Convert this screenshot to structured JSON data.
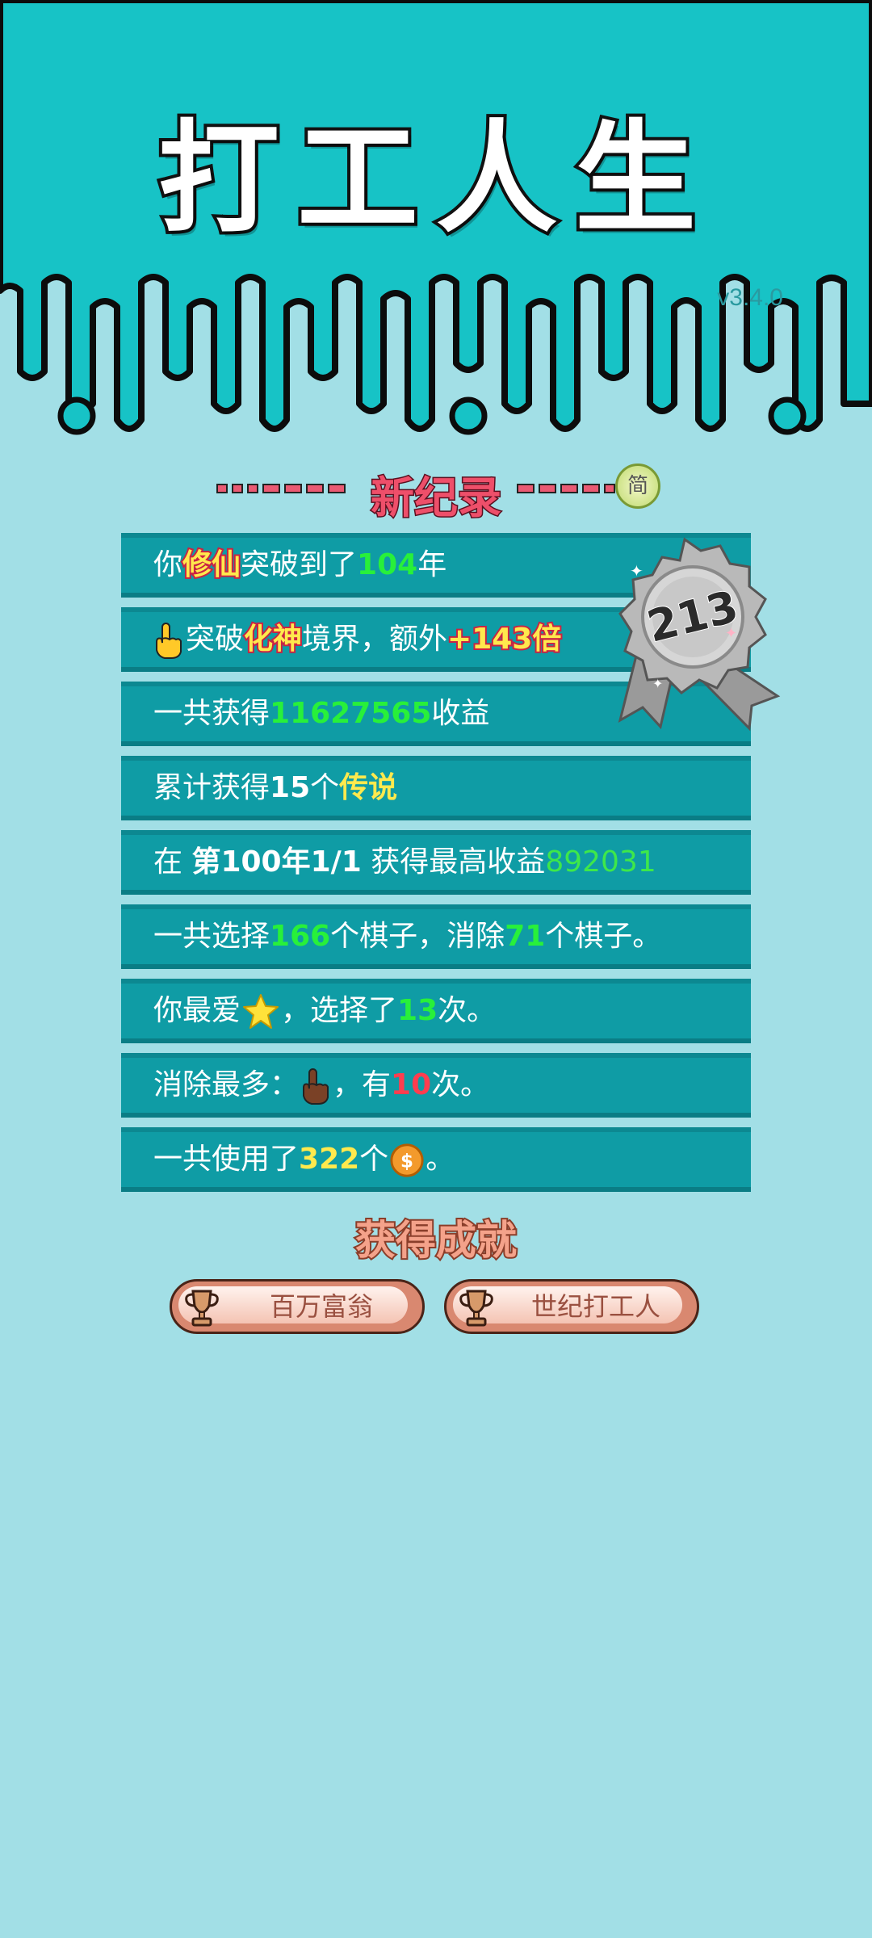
{
  "app": {
    "title": "打工人生",
    "version": "v3.4.0"
  },
  "record": {
    "title": "新纪录",
    "simplified_badge": "简"
  },
  "badge": {
    "number": "213"
  },
  "stats": [
    {
      "parts": [
        "你",
        "修仙",
        "突破到了",
        "104",
        "年"
      ]
    },
    {
      "parts": [
        "突破",
        "化神",
        "境界，额外",
        "+143倍"
      ]
    },
    {
      "parts": [
        "一共获得",
        "11627565",
        "收益"
      ]
    },
    {
      "parts": [
        "累计获得",
        "15",
        "个",
        "传说"
      ]
    },
    {
      "parts": [
        "在 ",
        "第100年1/1",
        " 获得最高收益",
        "892031"
      ]
    },
    {
      "parts": [
        "一共选择",
        "166",
        "个棋子，消除",
        "71",
        "个棋子。"
      ]
    },
    {
      "parts": [
        "你最爱",
        "，选择了",
        "13",
        "次。"
      ]
    },
    {
      "parts": [
        "消除最多：",
        "，有",
        "10",
        "次。"
      ]
    },
    {
      "parts": [
        "一共使用了",
        "322",
        "个",
        "。"
      ]
    }
  ],
  "icons": {
    "row2": "pointing-hand-icon",
    "row7": "star-icon",
    "row8": "brown-pointing-hand-icon",
    "row9": "coin-icon",
    "achievement": "trophy-icon"
  },
  "achievements": {
    "title": "获得成就",
    "items": [
      {
        "label": "百万富翁"
      },
      {
        "label": "世纪打工人"
      }
    ]
  },
  "colors": {
    "background": "#a2dfe6",
    "header": "#17c3c6",
    "row": "#0f9ca5",
    "green": "#28f03a",
    "yellow": "#ffe94d",
    "red": "#ff3d4f"
  }
}
